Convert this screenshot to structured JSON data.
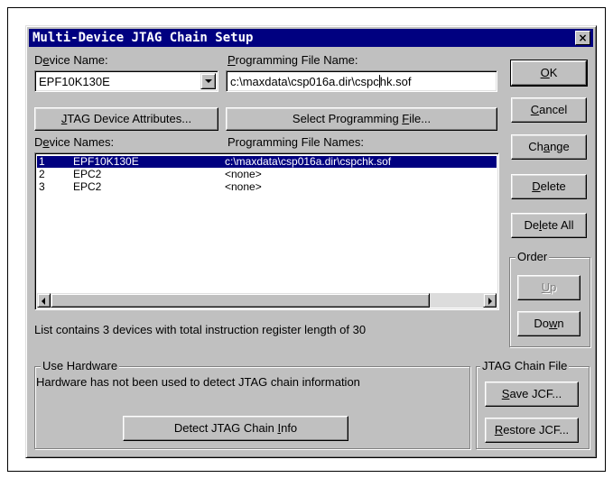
{
  "window": {
    "title": "Multi-Device JTAG Chain Setup",
    "close_label": "×"
  },
  "device_name": {
    "label_pre": "D",
    "label_u": "e",
    "label_post": "vice Name:",
    "value": "EPF10K130E"
  },
  "prog_file": {
    "label_u": "P",
    "label_post": "rogramming File Name:",
    "value_a": "c:\\maxdata\\csp016a.dir\\cspc",
    "value_b": "hk.sof"
  },
  "buttons": {
    "jtag_attr_u": "J",
    "jtag_attr_post": "TAG Device Attributes...",
    "select_file_pre": "Select Programming ",
    "select_file_u": "F",
    "select_file_post": "ile...",
    "ok_u": "O",
    "ok_post": "K",
    "cancel_u": "C",
    "cancel_post": "ancel",
    "change_pre": "Ch",
    "change_u": "a",
    "change_post": "nge",
    "delete_u": "D",
    "delete_post": "elete",
    "delete_all_pre": "De",
    "delete_all_u": "l",
    "delete_all_post": "ete All",
    "up_u": "U",
    "up_post": "p",
    "down_pre": "Do",
    "down_u": "w",
    "down_post": "n",
    "detect_pre": "Detect JTAG Chain ",
    "detect_u": "I",
    "detect_post": "nfo",
    "save_u": "S",
    "save_post": "ave JCF...",
    "restore_u": "R",
    "restore_post": "estore JCF..."
  },
  "list": {
    "device_names_pre": "D",
    "device_names_u": "e",
    "device_names_post": "vice Names:",
    "file_names_header": "Programming File Names:",
    "rows": [
      {
        "num": "1",
        "device": "EPF10K130E",
        "file": "c:\\maxdata\\csp016a.dir\\cspchk.sof"
      },
      {
        "num": "2",
        "device": "EPC2",
        "file": "<none>"
      },
      {
        "num": "3",
        "device": "EPC2",
        "file": "<none>"
      }
    ],
    "summary": "List contains 3 devices with total instruction register length of 30"
  },
  "order_group": {
    "legend": "Order"
  },
  "hardware_group": {
    "legend": "Use Hardware",
    "message": "Hardware has not been used to detect JTAG chain information"
  },
  "jcf_group": {
    "legend": "JTAG Chain File"
  },
  "colors": {
    "dialog_face": "#c0c0c0",
    "titlebar": "#000080",
    "selection": "#000080"
  }
}
